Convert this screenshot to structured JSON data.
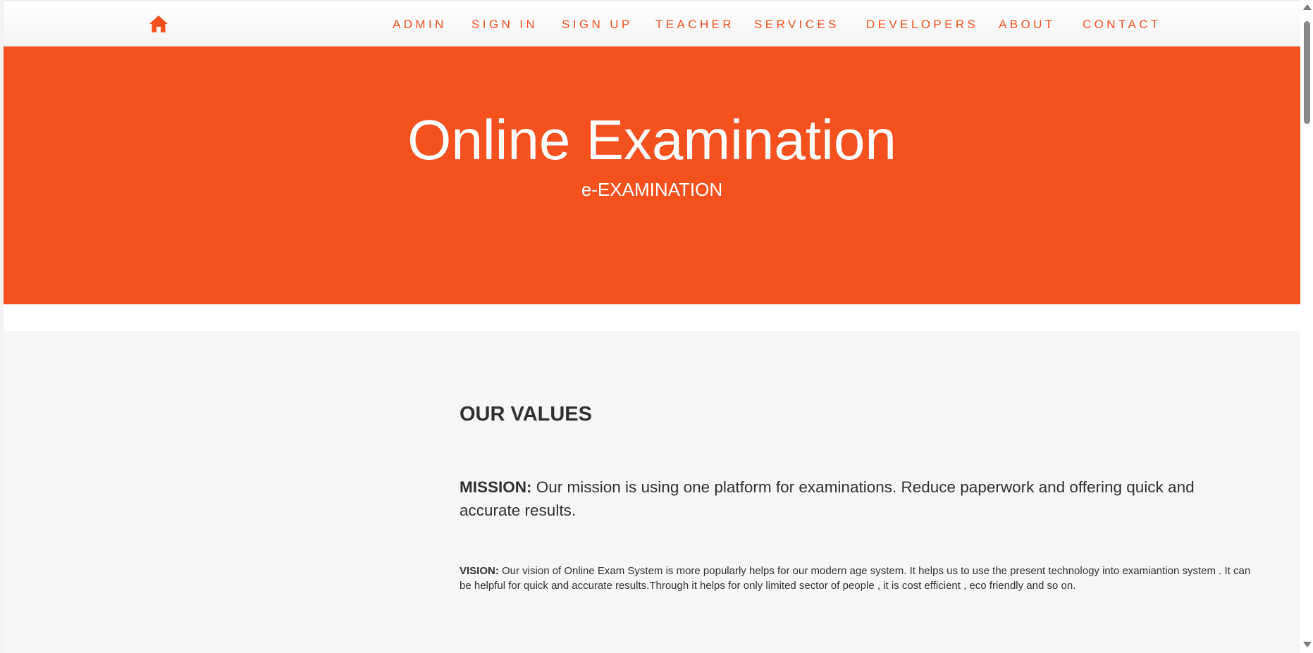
{
  "navbar": {
    "home_icon": "home-icon",
    "items": [
      {
        "label": "ADMIN"
      },
      {
        "label": "SIGN IN"
      },
      {
        "label": "SIGN UP"
      },
      {
        "label": "TEACHER"
      },
      {
        "label": "SERVICES"
      },
      {
        "label": "DEVELOPERS"
      },
      {
        "label": "ABOUT"
      },
      {
        "label": "CONTACT"
      }
    ]
  },
  "hero": {
    "title": "Online Examination",
    "subtitle": "e-EXAMINATION"
  },
  "values": {
    "title": "OUR VALUES",
    "mission_label": "MISSION:",
    "mission_text": " Our mission is using one platform for examinations. Reduce paperwork and offering quick and accurate results.",
    "vision_label": "VISION:",
    "vision_text": " Our vision of Online Exam System is more popularly helps for our modern age system. It helps us to use the present technology into examiantion system . It can be helpful for quick and accurate results.Through it helps for only limited sector of people , it is cost efficient , eco friendly and so on."
  },
  "colors": {
    "accent": "#f4511e",
    "section_bg": "#f6f6f6",
    "text": "#303030"
  }
}
